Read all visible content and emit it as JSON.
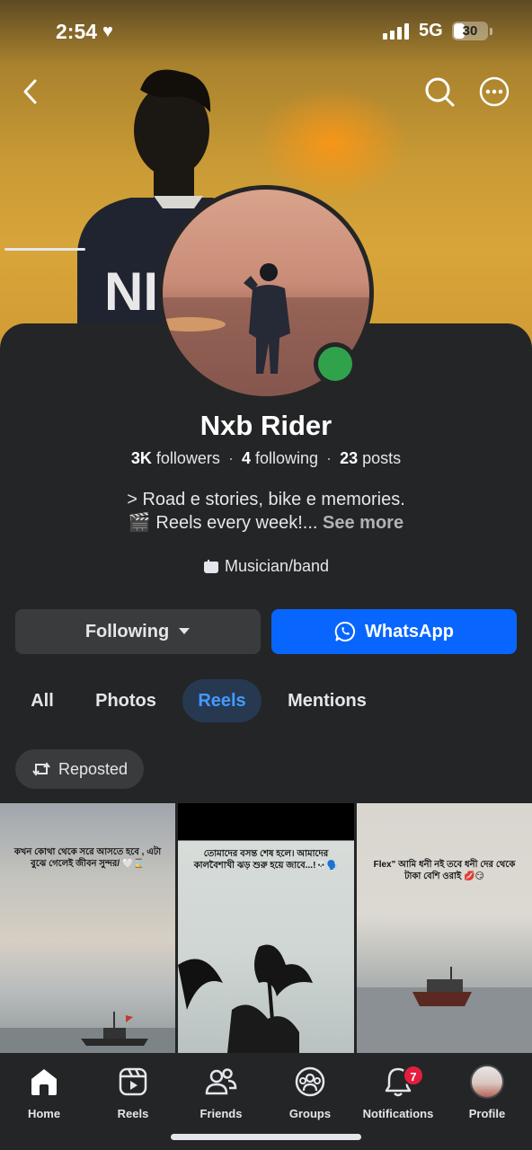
{
  "status_bar": {
    "time": "2:54",
    "network": "5G",
    "battery": "30"
  },
  "profile": {
    "name": "Nxb Rider",
    "followers_count": "3K",
    "followers_label": "followers",
    "following_count": "4",
    "following_label": "following",
    "posts_count": "23",
    "posts_label": "posts",
    "bio_line1": "> Road e stories, bike e memories.",
    "bio_line2": "🎬 Reels every week!...",
    "see_more": "See more",
    "category": "Musician/band"
  },
  "actions": {
    "following_label": "Following",
    "whatsapp_label": "WhatsApp"
  },
  "tabs": [
    {
      "label": "All",
      "active": false
    },
    {
      "label": "Photos",
      "active": false
    },
    {
      "label": "Reels",
      "active": true
    },
    {
      "label": "Mentions",
      "active": false
    }
  ],
  "filter_chip": "Reposted",
  "reels": [
    {
      "caption": "কখন কোথা থেকে সরে আসতে হবে , এটা বুঝে গেলেই জীবন সুন্দর/ 🤍⌛"
    },
    {
      "caption": "তোমাদের বসন্ত শেষ হলে। আমাদের কালবৈশাখী ঝড় শুরু হয়ে জাবে...!💀🗣️"
    },
    {
      "caption": "Flex\" আমি ধনী নই তবে ধনী দের থেকে টাকা বেশি ওরাই 💋😏"
    }
  ],
  "bottom_nav": [
    {
      "label": "Home",
      "icon": "home-icon",
      "active": true
    },
    {
      "label": "Reels",
      "icon": "reels-icon",
      "active": false
    },
    {
      "label": "Friends",
      "icon": "friends-icon",
      "active": false
    },
    {
      "label": "Groups",
      "icon": "groups-icon",
      "active": false
    },
    {
      "label": "Notifications",
      "icon": "bell-icon",
      "active": false,
      "badge": "7"
    },
    {
      "label": "Profile",
      "icon": "profile-avatar",
      "active": false
    }
  ],
  "colors": {
    "background": "#242526",
    "accent": "#0866ff",
    "active_tab_bg": "#263951",
    "active_tab_text": "#4599ff",
    "online": "#31a24c",
    "badge": "#e41e3f"
  }
}
